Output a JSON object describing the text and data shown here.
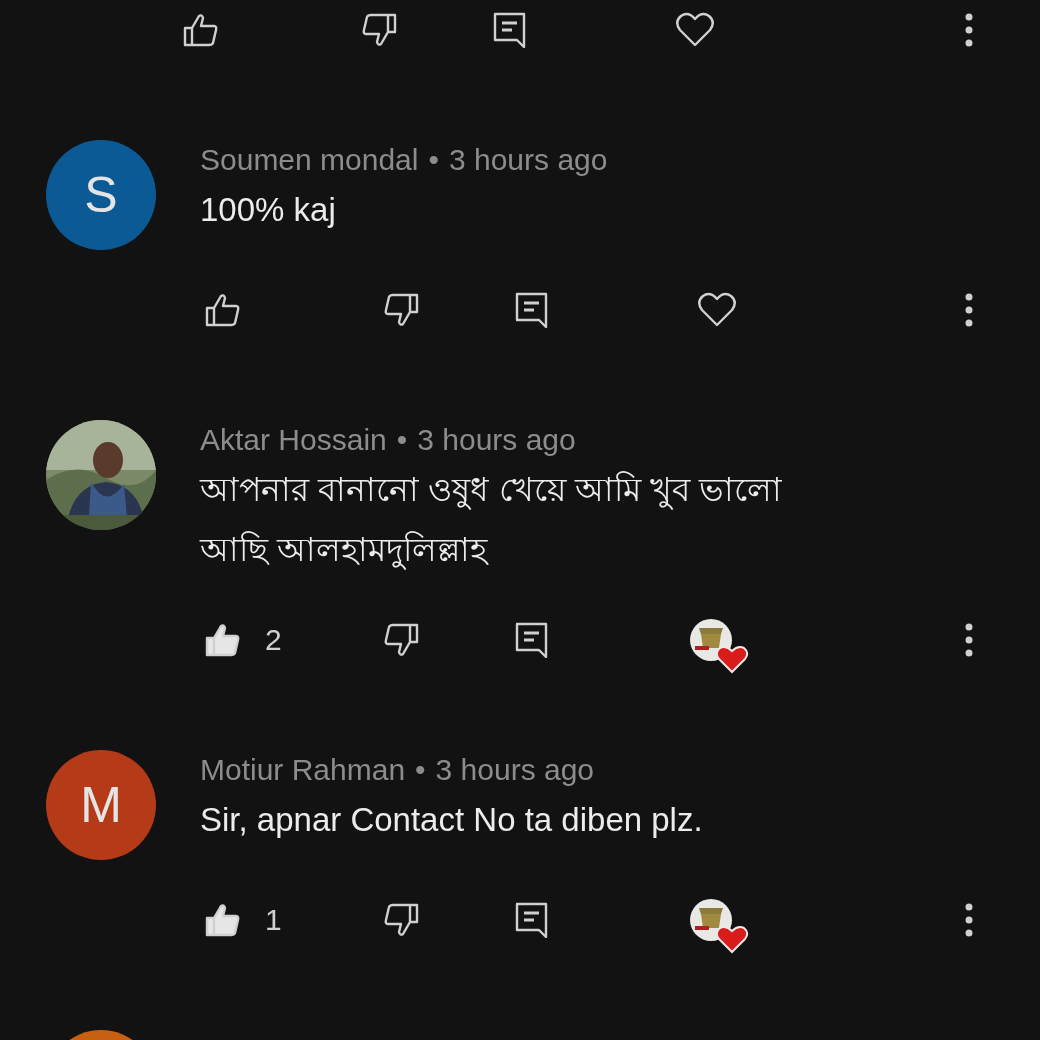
{
  "previous_comment_actions": {
    "liked": false,
    "hearted": false
  },
  "comments": [
    {
      "avatar": {
        "kind": "letter",
        "letter": "S",
        "color": "#0b5a96"
      },
      "author": "Soumen mondal",
      "separator": "•",
      "time": "3 hours ago",
      "text": "100% kaj",
      "liked": false,
      "hearted": false
    },
    {
      "author": "Aktar Hossain",
      "separator": "•",
      "time": "3 hours ago",
      "text": "আপনার বানানো ওষুধ খেয়ে আমি খুব ভালো আছি আলহামদুলিল্লাহ",
      "liked": true,
      "like_count": "2",
      "hearted": true
    },
    {
      "avatar": {
        "kind": "letter",
        "letter": "M",
        "color": "#b53a17"
      },
      "author": "Motiur Rahman",
      "separator": "•",
      "time": "3 hours ago",
      "text": "Sir, apnar Contact No ta diben plz.",
      "liked": true,
      "like_count": "1",
      "hearted": true
    },
    {
      "avatar": {
        "kind": "cut",
        "color": "#c76010"
      }
    }
  ]
}
